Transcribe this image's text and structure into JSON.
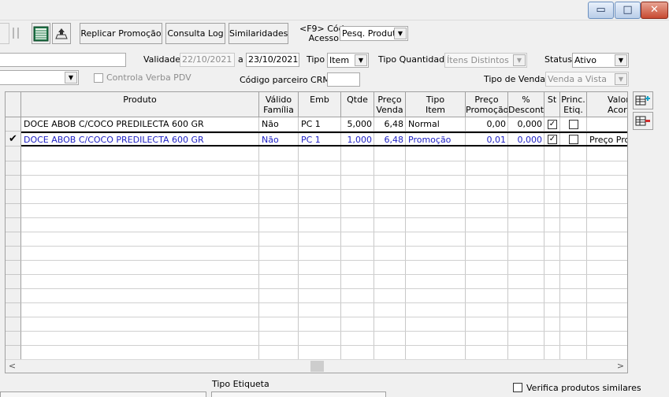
{
  "window": {
    "minimize": "▭",
    "maximize": "□",
    "close": "✕"
  },
  "toolbar": {
    "replicar": "Replicar Promoção",
    "consulta_log": "Consulta Log",
    "similaridades": "Similaridades",
    "cod_acesso_label_1": "<F9> Cód",
    "cod_acesso_label_2": "Acesso",
    "pesq_value": "Pesq. Produtc"
  },
  "filters": {
    "validade_label": "Validade",
    "validade_from": "22/10/2021",
    "a_label": "a",
    "validade_to": "23/10/2021",
    "tipo_label": "Tipo",
    "tipo_value": "Item",
    "tipo_qtd_label": "Tipo Quantidade",
    "tipo_qtd_value": "Ítens Distintos",
    "status_label": "Status",
    "status_value": "Ativo",
    "controla_verba": "Controla Verba PDV",
    "codigo_crm_label": "Código parceiro CRM",
    "codigo_crm_value": "",
    "tipo_venda_label": "Tipo de Venda",
    "tipo_venda_value": "Venda a Vista"
  },
  "grid": {
    "headers": {
      "produto": "Produto",
      "valido": "Válido\nFamília",
      "emb": "Emb",
      "qtde": "Qtde",
      "preco_venda": "Preço\nVenda",
      "tipo_item": "Tipo\nItem",
      "preco_promo": "Preço\nPromoção",
      "desc": "%\nDesconto",
      "st": "St",
      "princ": "Princ.\nEtiq.",
      "valor": "Valor\nAcordo"
    },
    "rows": [
      {
        "produto": "DOCE ABOB C/COCO PREDILECTA 600 GR",
        "valido": "Não",
        "emb": "PC  1",
        "qtde": "5,000",
        "preco_venda": "6,48",
        "tipo_item": "Normal",
        "preco_promo": "0,00",
        "desc": "0,000",
        "st": "✓",
        "princ": "",
        "valor": ""
      },
      {
        "produto": "DOCE ABOB C/COCO PREDILECTA 600 GR",
        "valido": "Não",
        "emb": "PC  1",
        "qtde": "1,000",
        "preco_venda": "6,48",
        "tipo_item": "Promoção",
        "preco_promo": "0,01",
        "desc": "0,000",
        "st": "✓",
        "princ": "",
        "valor": "Preço Pro"
      }
    ],
    "selected_indicator": "✔"
  },
  "scroll": {
    "left": "<",
    "right": ">"
  },
  "bottom": {
    "tipo_etiqueta_label": "Tipo Etiqueta",
    "verifica_label": "Verifica produtos similares"
  }
}
